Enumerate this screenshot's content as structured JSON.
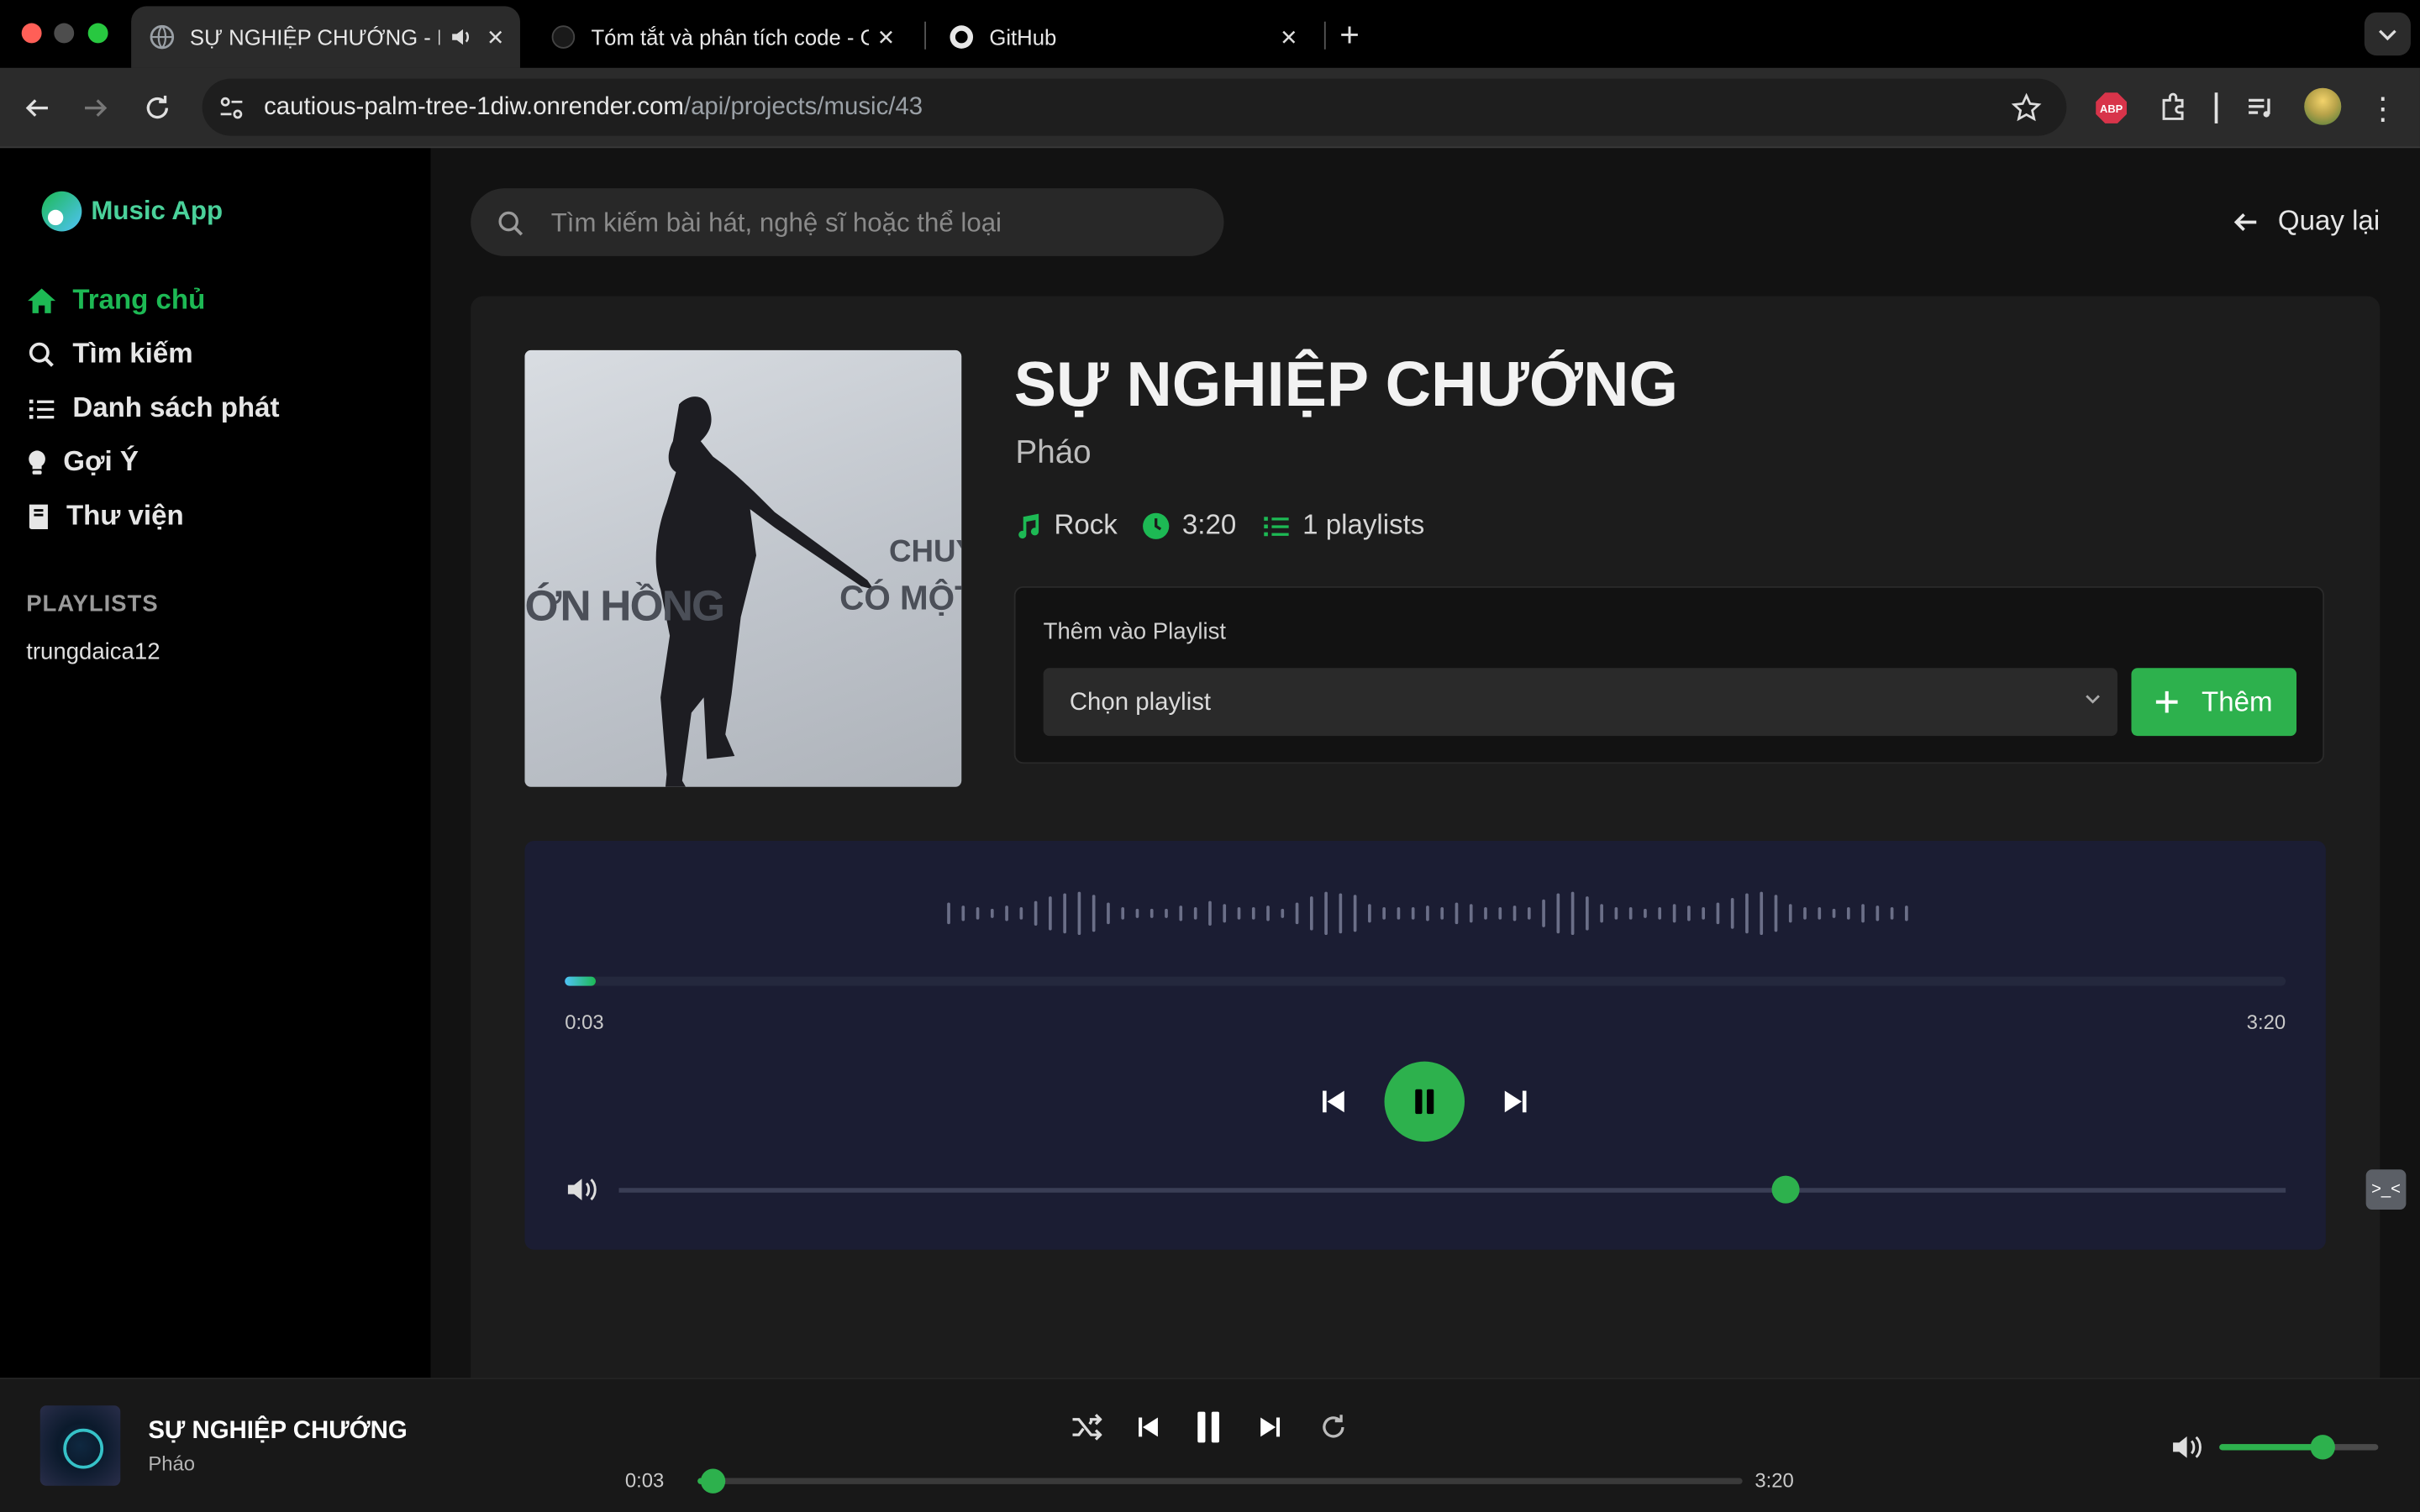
{
  "browser": {
    "tabs": [
      {
        "title": "SỰ NGHIỆP CHƯỚNG - Music App",
        "active": true
      },
      {
        "title": "Tóm tắt và phân tích code - GitHub Copilot",
        "active": false
      },
      {
        "title": "GitHub",
        "active": false
      }
    ],
    "url_host": "cautious-palm-tree-1diw.onrender.com",
    "url_path": "/api/projects/music/43"
  },
  "sidebar": {
    "app_name": "Music App",
    "nav": [
      {
        "label": "Trang chủ",
        "icon": "home-icon",
        "active": true
      },
      {
        "label": "Tìm kiếm",
        "icon": "search-icon",
        "active": false
      },
      {
        "label": "Danh sách phát",
        "icon": "list-icon",
        "active": false
      },
      {
        "label": "Gợi Ý",
        "icon": "lightbulb-icon",
        "active": false
      },
      {
        "label": "Thư viện",
        "icon": "book-icon",
        "active": false
      }
    ],
    "playlists_heading": "PLAYLISTS",
    "playlists": [
      "trungdaica12"
    ]
  },
  "header": {
    "search_placeholder": "Tìm kiếm bài hát, nghệ sĩ hoặc thể loại",
    "back_label": "Quay lại"
  },
  "song": {
    "title": "SỰ NGHIỆP CHƯỚNG",
    "artist": "Pháo",
    "genre": "Rock",
    "duration": "3:20",
    "playlists_count": "1 playlists",
    "cover_text_left": "ỚN HỒNG",
    "cover_text_right_1": "CHUYỆ",
    "cover_text_right_2": "CÓ MỘT N"
  },
  "add_to_playlist": {
    "label": "Thêm vào Playlist",
    "select_value": "Chọn playlist",
    "button_label": "Thêm"
  },
  "player": {
    "current_time": "0:03",
    "total_time": "3:20",
    "progress": 0.015,
    "volume": 0.7
  },
  "bottom_player": {
    "title": "SỰ NGHIỆP CHƯỚNG",
    "artist": "Pháo",
    "current_time": "0:03",
    "total_time": "3:20",
    "progress": 0.015,
    "volume": 0.65
  },
  "colors": {
    "accent": "#2db14d",
    "sidebar_bg": "#000000",
    "main_bg": "#121212",
    "player_bg": "#1b1d33"
  }
}
